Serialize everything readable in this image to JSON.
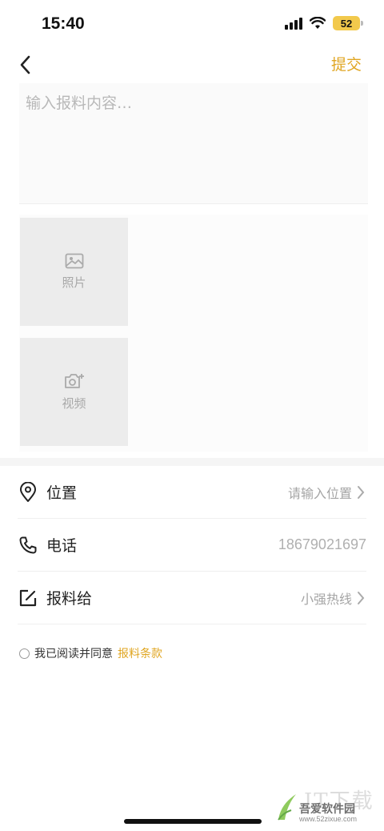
{
  "status_bar": {
    "time": "15:40",
    "battery": "52"
  },
  "nav": {
    "back_icon": "chevron-left-icon",
    "submit_label": "提交"
  },
  "report": {
    "placeholder": "输入报料内容…"
  },
  "media": {
    "photo_label": "照片",
    "photo_icon": "image-icon",
    "video_label": "视频",
    "video_icon": "camera-plus-icon"
  },
  "rows": {
    "location": {
      "label": "位置",
      "value": "请输入位置",
      "icon": "location-pin-icon"
    },
    "phone": {
      "label": "电话",
      "value": "18679021697",
      "icon": "phone-icon"
    },
    "report_to": {
      "label": "报料给",
      "value": "小强热线",
      "icon": "edit-icon"
    }
  },
  "agreement": {
    "text": "我已阅读并同意",
    "link": "报料条款"
  },
  "watermark": {
    "top": "IT下载",
    "name": "吾爱软件园",
    "url": "www.52zixue.com"
  },
  "colors": {
    "accent": "#e0a622",
    "placeholder": "#b8b8b8",
    "tile_bg": "#ececec"
  }
}
